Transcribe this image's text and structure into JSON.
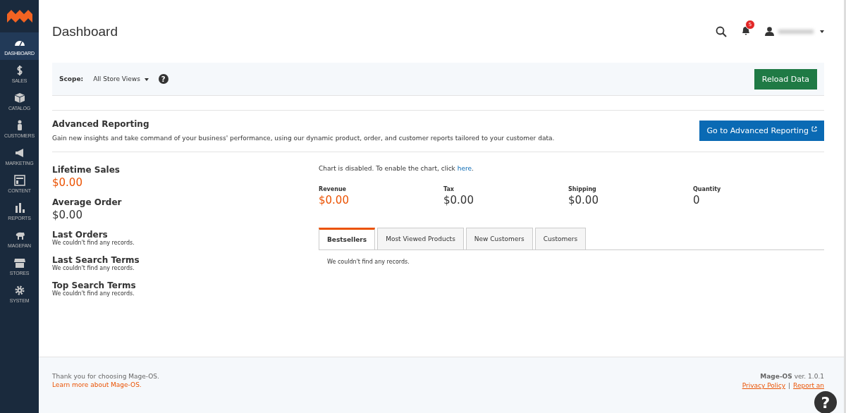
{
  "sidebar": {
    "items": [
      {
        "label": "DASHBOARD",
        "kind": "dashboard",
        "selected": true
      },
      {
        "label": "SALES",
        "kind": "sales",
        "selected": false
      },
      {
        "label": "CATALOG",
        "kind": "catalog",
        "selected": false
      },
      {
        "label": "CUSTOMERS",
        "kind": "customers",
        "selected": false
      },
      {
        "label": "MARKETING",
        "kind": "marketing",
        "selected": false
      },
      {
        "label": "CONTENT",
        "kind": "content",
        "selected": false
      },
      {
        "label": "REPORTS",
        "kind": "reports",
        "selected": false
      },
      {
        "label": "MAGEFAN",
        "kind": "magefan",
        "selected": false
      },
      {
        "label": "STORES",
        "kind": "stores",
        "selected": false
      },
      {
        "label": "SYSTEM",
        "kind": "system",
        "selected": false
      }
    ]
  },
  "header": {
    "title": "Dashboard",
    "notification_count": "5"
  },
  "scope": {
    "label": "Scope:",
    "value": "All Store Views",
    "help": "?",
    "button": "Reload Data"
  },
  "advanced": {
    "title": "Advanced Reporting",
    "text": "Gain new insights and take command of your business' performance, using our dynamic product, order, and customer reports tailored to your customer data.",
    "button": "Go to Advanced Reporting"
  },
  "left": {
    "stats": [
      {
        "title": "Lifetime Sales",
        "value": "$0.00",
        "highlight": true
      },
      {
        "title": "Average Order",
        "value": "$0.00",
        "highlight": false
      }
    ],
    "lists": [
      {
        "title": "Last Orders",
        "text": "We couldn't find any records."
      },
      {
        "title": "Last Search Terms",
        "text": "We couldn't find any records."
      },
      {
        "title": "Top Search Terms",
        "text": "We couldn't find any records."
      }
    ]
  },
  "chart_notice": {
    "text": "Chart is disabled. To enable the chart, click ",
    "link": "here",
    "end": "."
  },
  "totals": [
    {
      "label": "Revenue",
      "value": "$0.00",
      "highlight": true
    },
    {
      "label": "Tax",
      "value": "$0.00",
      "highlight": false
    },
    {
      "label": "Shipping",
      "value": "$0.00",
      "highlight": false
    },
    {
      "label": "Quantity",
      "value": "0",
      "highlight": false
    }
  ],
  "tabs": [
    {
      "label": "Bestsellers",
      "selected": true
    },
    {
      "label": "Most Viewed Products",
      "selected": false
    },
    {
      "label": "New Customers",
      "selected": false
    },
    {
      "label": "Customers",
      "selected": false
    }
  ],
  "tab_content": "We couldn't find any records.",
  "footer": {
    "thanks": "Thank you for choosing Mage-OS.",
    "learn": "Learn more about Mage-OS.",
    "brand": "Mage-OS",
    "version": " ver. 1.0.1",
    "privacy": "Privacy Policy",
    "separator": "|",
    "report": "Report an",
    "help": "?"
  }
}
